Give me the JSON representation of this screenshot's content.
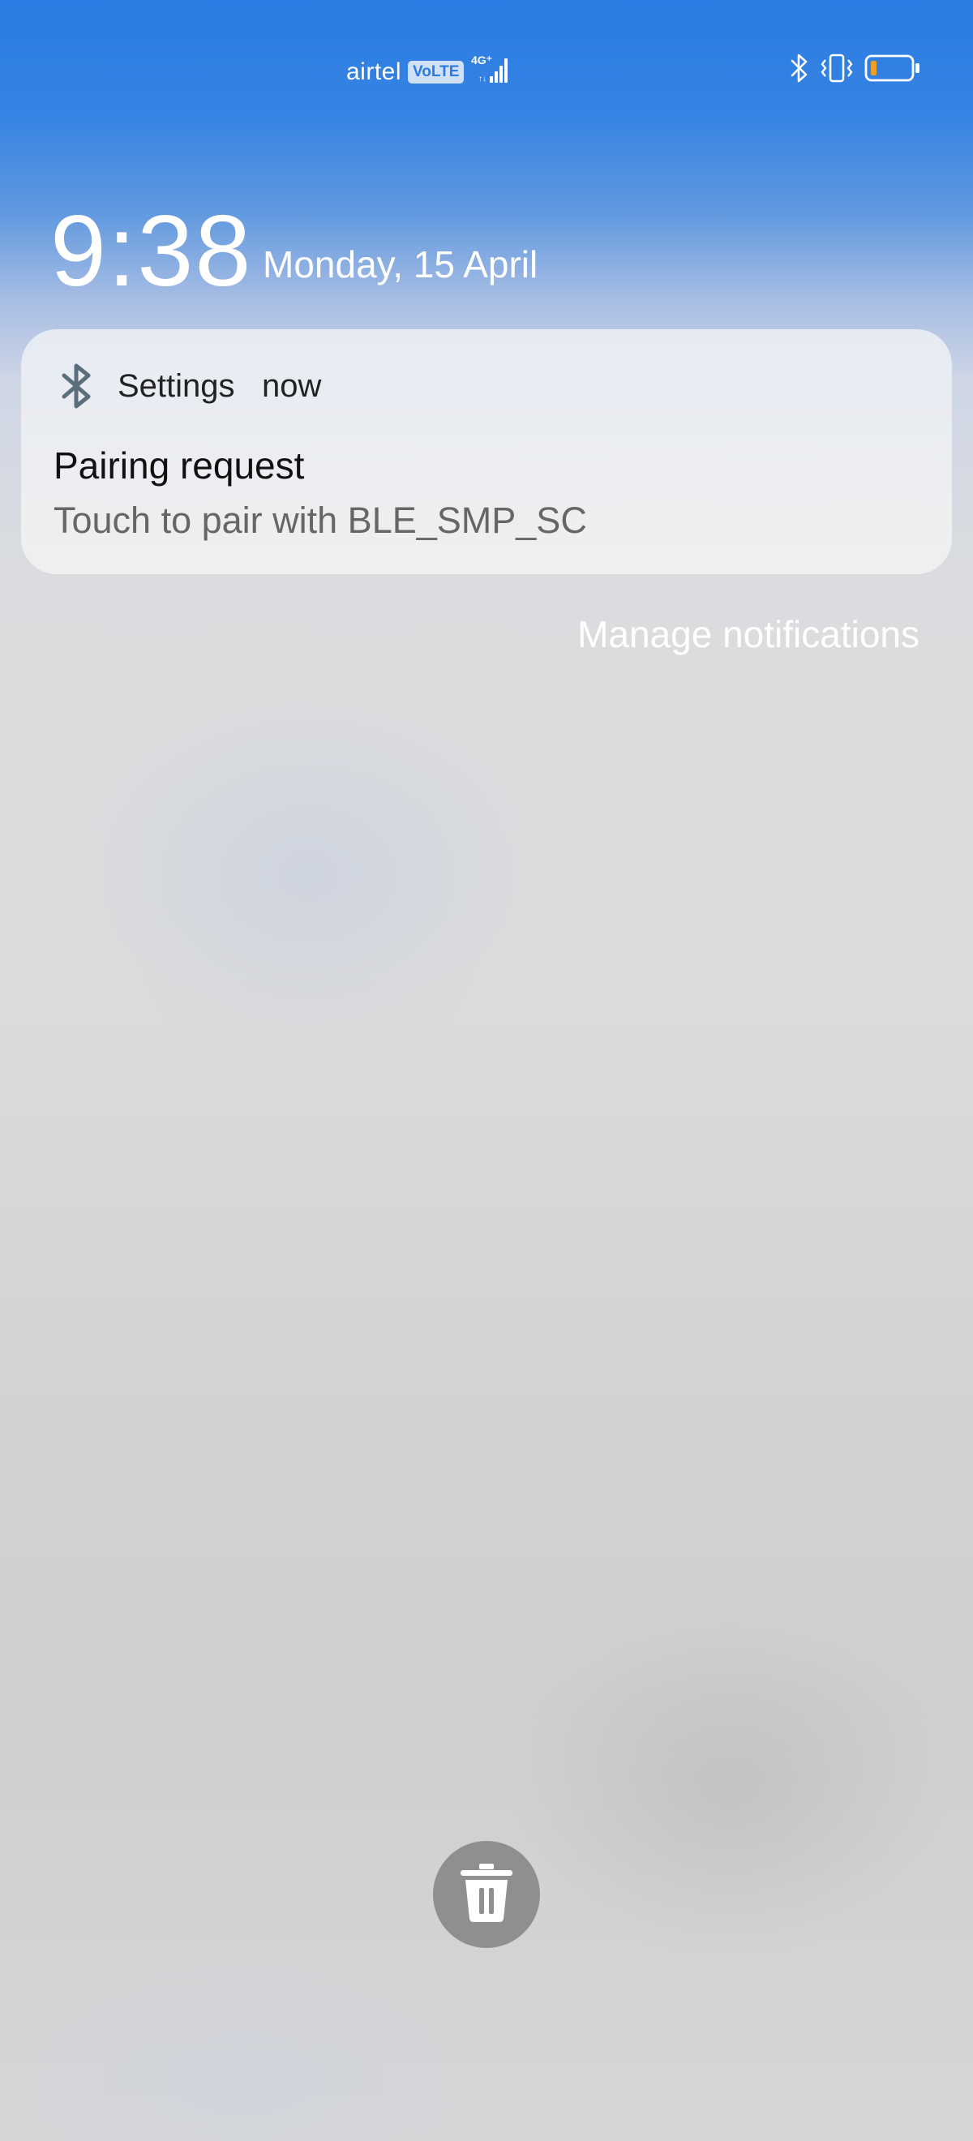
{
  "status_bar": {
    "carrier": "airtel",
    "volte_badge": "VoLTE",
    "network_type": "4G⁺",
    "icons": [
      "signal-icon",
      "bluetooth-icon",
      "vibrate-icon",
      "battery-icon"
    ],
    "battery_color": "#f0a020"
  },
  "lockscreen": {
    "time": "9:38",
    "date": "Monday, 15 April"
  },
  "notification": {
    "app_icon": "bluetooth-icon",
    "app_name": "Settings",
    "time": "now",
    "title": "Pairing request",
    "body": "Touch to pair with BLE_SMP_SC"
  },
  "manage_notifications_label": "Manage notifications",
  "clear_button_icon": "trash-icon",
  "colors": {
    "sky_blue": "#2b7be2",
    "card_bg": "#eceef2",
    "clear_button_bg": "#8f8f8f"
  }
}
